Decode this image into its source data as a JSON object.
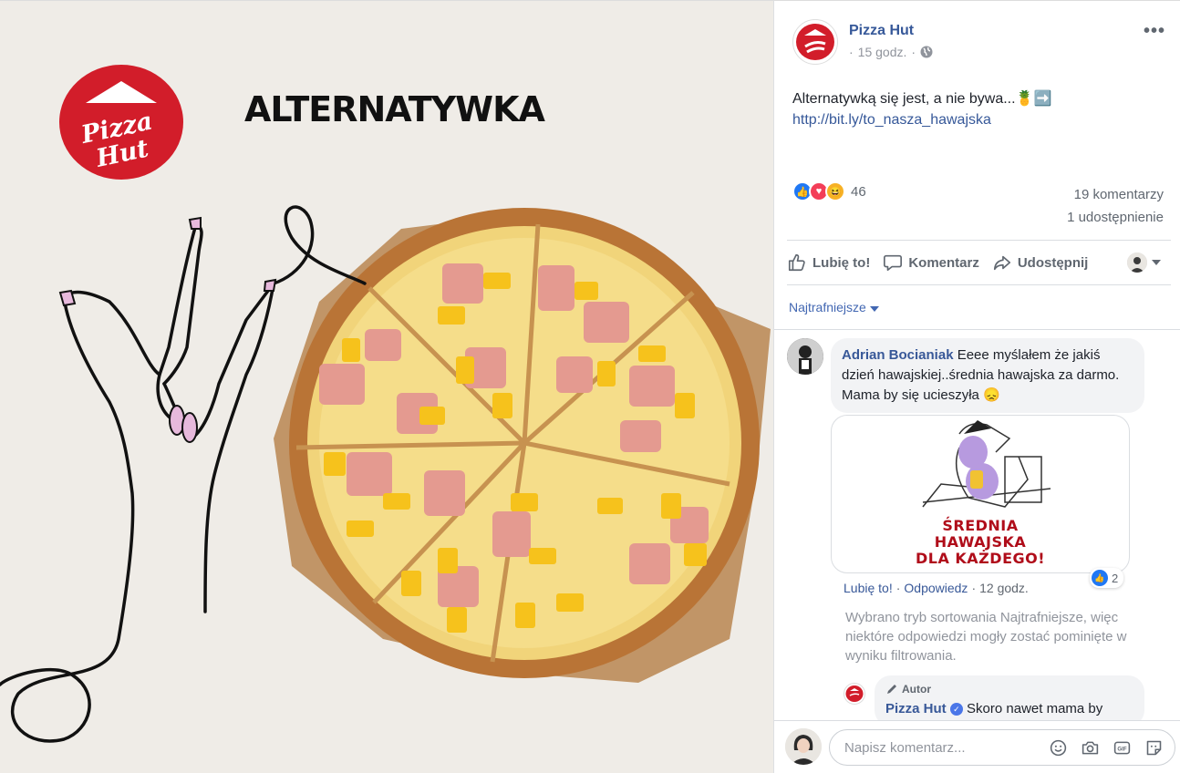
{
  "photo": {
    "brand_line1": "Pizza",
    "brand_line2": "Hut",
    "headline": "ALTERNATYWKA"
  },
  "post": {
    "page_name": "Pizza Hut",
    "time": "15 godz.",
    "separator": "·",
    "text": "Alternatywką się jest, a nie bywa...🍍➡️ ",
    "link": "http://bit.ly/to_nasza_hawajska",
    "reaction_count": "46",
    "comments": "19 komentarzy",
    "shares": "1 udostępnienie"
  },
  "actions": {
    "like": "Lubię to!",
    "comment": "Komentarz",
    "share": "Udostępnij"
  },
  "sort_label": "Najtrafniejsze",
  "comment": {
    "author": "Adrian Bocianiak",
    "text": " Eeee myślałem że jakiś dzień hawajskiej..średnia hawajska za darmo. Mama by się ucieszyła 😞",
    "image_caption_1": "ŚREDNIA",
    "image_caption_2": "HAWAJSKA",
    "image_caption_3": "DLA KAŻDEGO!",
    "like_link": "Lubię to!",
    "reply_link": "Odpowiedz",
    "time": "12 godz.",
    "dot": "·",
    "reaction_count": "2"
  },
  "notice": "Wybrano tryb sortowania Najtrafniejsze, więc niektóre odpowiedzi mogły zostać pominięte w wyniku filtrowania.",
  "reply": {
    "badge": "Autor",
    "author": "Pizza Hut",
    "text": " Skoro nawet mama by"
  },
  "composer": {
    "placeholder": "Napisz komentarz..."
  },
  "colors": {
    "brand_red": "#d21d2a",
    "link_blue": "#365899",
    "accent_blue": "#4267b2"
  }
}
